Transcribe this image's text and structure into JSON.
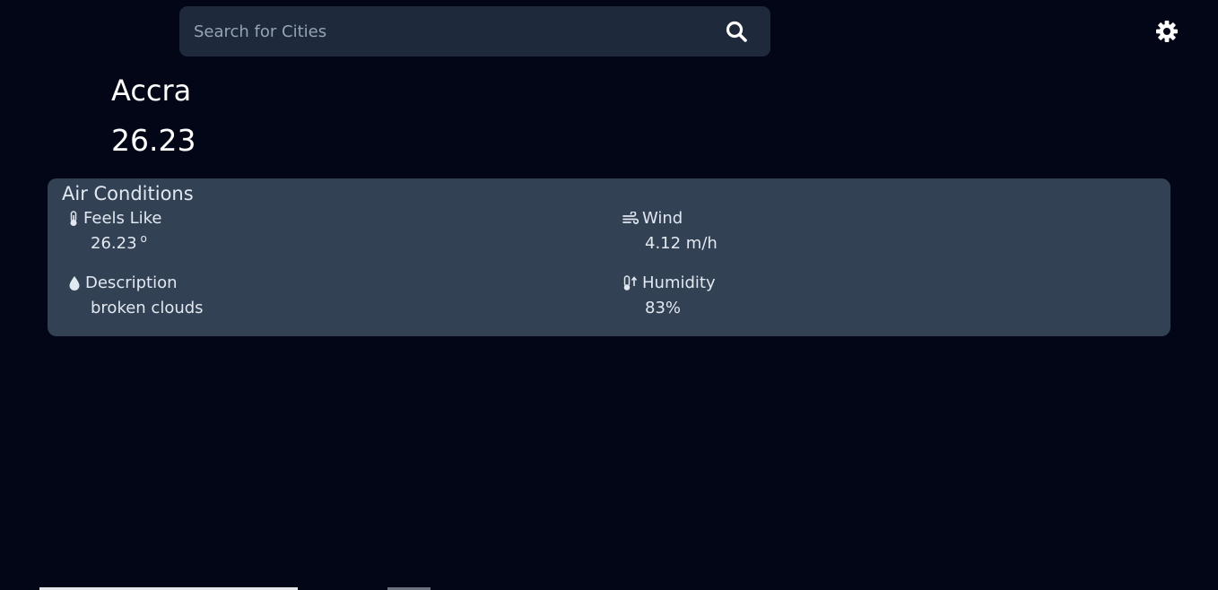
{
  "search": {
    "placeholder": "Search for Cities",
    "value": ""
  },
  "icons": {
    "search": "search-icon",
    "settings": "gear-icon",
    "feels_like": "thermometer-icon",
    "description": "droplet-icon",
    "wind": "wind-icon",
    "humidity": "temperature-arrow-icon"
  },
  "weather": {
    "city": "Accra",
    "temperature": "26.23"
  },
  "air_conditions": {
    "title": "Air Conditions",
    "feels_like": {
      "label": "Feels Like",
      "value": "26.23",
      "unit": "o"
    },
    "wind": {
      "label": "Wind",
      "value": "4.12 m/h"
    },
    "description": {
      "label": "Description",
      "value": "broken clouds"
    },
    "humidity": {
      "label": "Humidity",
      "value": "83%"
    }
  },
  "colors": {
    "background": "#020617",
    "search_bg": "#1e293b",
    "card_bg": "#334155",
    "text": "#e2e8f0"
  }
}
